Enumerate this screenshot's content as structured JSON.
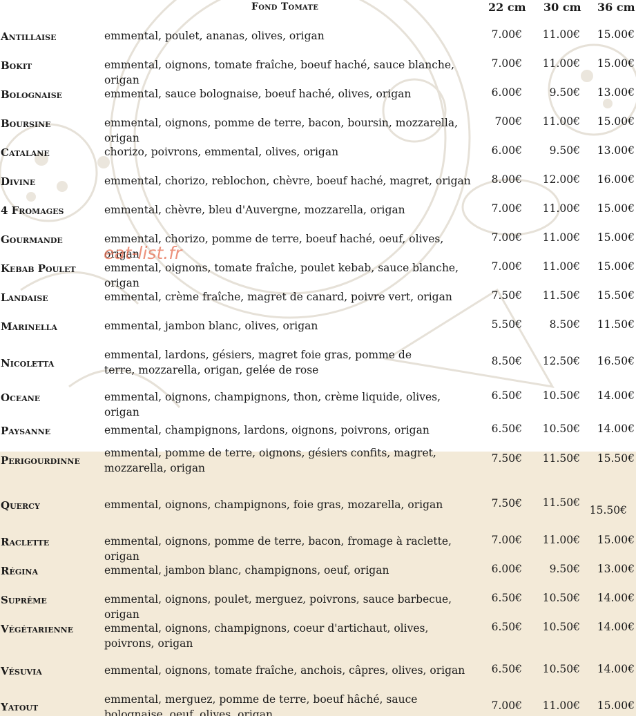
{
  "menu": {
    "base_title": "Fond Tomate",
    "sizes": [
      "22 cm",
      "30 cm",
      "36 cm"
    ],
    "watermark": "eat-list.fr",
    "pizzas": [
      {
        "name": "Antillaise",
        "ingredients": "emmental, poulet, ananas, olives, origan",
        "prices": [
          "7.00€",
          "11.00€",
          "15.00€"
        ]
      },
      {
        "name": "Bokit",
        "ingredients": "emmental, oignons, tomate fraîche, boeuf haché, sauce blanche, origan",
        "prices": [
          "7.00€",
          "11.00€",
          "15.00€"
        ]
      },
      {
        "name": "Bolognaise",
        "ingredients": "emmental, sauce bolognaise, boeuf haché, olives, origan",
        "prices": [
          "6.00€",
          "9.50€",
          "13.00€"
        ]
      },
      {
        "name": "Boursine",
        "ingredients": "emmental, oignons, pomme de terre, bacon, boursin, mozzarella, origan",
        "prices": [
          "700€",
          "11.00€",
          "15.00€"
        ]
      },
      {
        "name": "Catalane",
        "ingredients": "chorizo, poivrons, emmental, olives, origan",
        "prices": [
          "6.00€",
          "9.50€",
          "13.00€"
        ]
      },
      {
        "name": "Divine",
        "ingredients": "emmental, chorizo, reblochon, chèvre, boeuf haché, magret, origan",
        "prices": [
          "8.00€",
          "12.00€",
          "16.00€"
        ]
      },
      {
        "name": "4 Fromages",
        "ingredients": "emmental, chèvre, bleu d'Auvergne, mozzarella, origan",
        "prices": [
          "7.00€",
          "11.00€",
          "15.00€"
        ]
      },
      {
        "name": "Gourmande",
        "ingredients": "emmental, chorizo, pomme de terre, boeuf haché, oeuf, olives, origan",
        "prices": [
          "7.00€",
          "11.00€",
          "15.00€"
        ]
      },
      {
        "name": "Kebab Poulet",
        "ingredients": "emmental, oignons, tomate fraîche, poulet kebab, sauce blanche, origan",
        "prices": [
          "7.00€",
          "11.00€",
          "15.00€"
        ]
      },
      {
        "name": "Landaise",
        "ingredients": "emmental, crème fraîche, magret de canard, poivre vert, origan",
        "prices": [
          "7.50€",
          "11.50€",
          "15.50€"
        ]
      },
      {
        "name": "Marinella",
        "ingredients": "emmental, jambon blanc, olives, origan",
        "prices": [
          "5.50€",
          "8.50€",
          "11.50€"
        ]
      },
      {
        "name": "Nicoletta",
        "ingredients": "emmental, lardons, gésiers, magret foie gras, pomme de terre, mozzarella, origan, gelée de rose",
        "prices": [
          "8.50€",
          "12.50€",
          "16.50€"
        ]
      },
      {
        "name": "Oceane",
        "ingredients": "emmental, oignons, champignons, thon, crème liquide, olives, origan",
        "prices": [
          "6.50€",
          "10.50€",
          "14.00€"
        ]
      },
      {
        "name": "Paysanne",
        "ingredients": "emmental, champignons, lardons, oignons, poivrons, origan",
        "prices": [
          "6.50€",
          "10.50€",
          "14.00€"
        ]
      },
      {
        "name": "Perigourdinne",
        "ingredients": "emmental, pomme de terre, oignons, gésiers confits, magret, mozzarella, origan",
        "prices": [
          "7.50€",
          "11.50€",
          "15.50€"
        ]
      },
      {
        "name": "Quercy",
        "ingredients": "emmental, oignons, champignons, foie gras, mozarella, origan",
        "prices": [
          "7.50€",
          "11.50€",
          "15.50€"
        ]
      },
      {
        "name": "Raclette",
        "ingredients": "emmental, oignons, pomme de terre, bacon, fromage à raclette, origan",
        "prices": [
          "7.00€",
          "11.00€",
          "15.00€"
        ]
      },
      {
        "name": "Régina",
        "ingredients": "emmental, jambon blanc, champignons, oeuf, origan",
        "prices": [
          "6.00€",
          "9.50€",
          "13.00€"
        ]
      },
      {
        "name": "Suprême",
        "ingredients": "emmental, oignons, poulet, merguez, poivrons, sauce barbecue, origan",
        "prices": [
          "6.50€",
          "10.50€",
          "14.00€"
        ]
      },
      {
        "name": "Végétarienne",
        "ingredients": "emmental, oignons, champignons, coeur d'artichaut, olives, poivrons, origan",
        "prices": [
          "6.50€",
          "10.50€",
          "14.00€"
        ]
      },
      {
        "name": "Vésuvia",
        "ingredients": "emmental, oignons, tomate fraîche, anchois, câpres, olives, origan",
        "prices": [
          "6.50€",
          "10.50€",
          "14.00€"
        ]
      },
      {
        "name": "Yatout",
        "ingredients": "emmental, merguez, pomme de terre, boeuf hâché, sauce bolognaise, oeuf, olives, origan",
        "prices": [
          "7.00€",
          "11.00€",
          "15.00€"
        ]
      }
    ]
  }
}
